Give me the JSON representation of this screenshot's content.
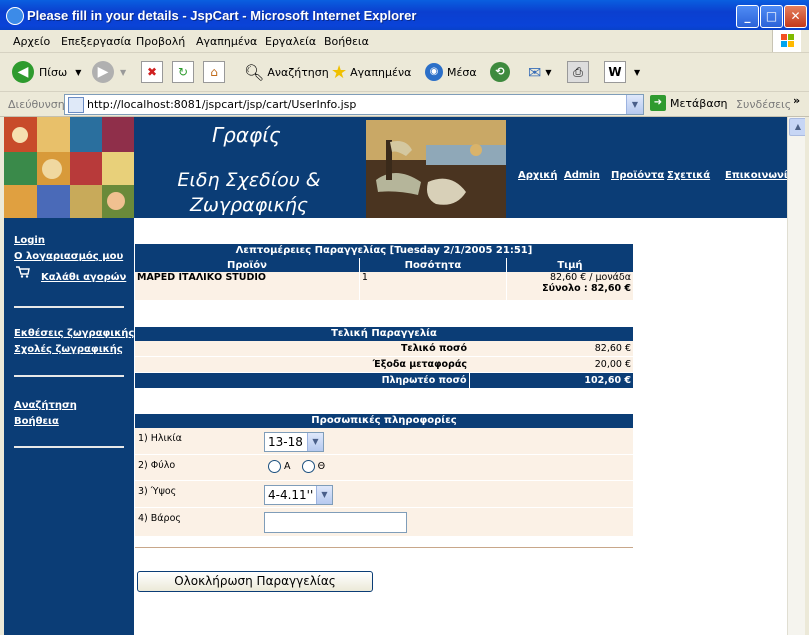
{
  "window": {
    "title": "Please fill in your details - JspCart - Microsoft Internet Explorer"
  },
  "menu": [
    "Αρχείο",
    "Επεξεργασία",
    "Προβολή",
    "Αγαπημένα",
    "Εργαλεία",
    "Βοήθεια"
  ],
  "toolbar": {
    "back": "Πίσω",
    "search": "Αναζήτηση",
    "favorites": "Αγαπημένα",
    "media": "Μέσα"
  },
  "address": {
    "label": "Διεύθυνση",
    "url": "http://localhost:8081/jspcart/jsp/cart/UserInfo.jsp",
    "go": "Μετάβαση",
    "links": "Συνδέσεις"
  },
  "banner": {
    "title": "Γραφίς",
    "subtitle": "Ειδη Σχεδίου & Ζωγραφικής"
  },
  "nav": [
    "Αρχική",
    "Admin",
    "Προϊόντα",
    "Σχετικά",
    "Επικοινωνία"
  ],
  "sidebar": {
    "login": "Login",
    "account": "Ο λογαριασμός μου",
    "cart": "Καλάθι αγορών",
    "exhibitions": "Εκθέσεις ζωγραφικής",
    "schools": "Σχολές ζωγραφικής",
    "search": "Αναζήτηση",
    "help": "Βοήθεια"
  },
  "order": {
    "header": "Λεπτομέρειες Παραγγελίας [Tuesday 2/1/2005 21:51]",
    "columns": [
      "Προϊόν",
      "Ποσότητα",
      "Τιμή"
    ],
    "product": "MAPED ΙΤΑΛΙΚΟ STUDIO",
    "quantity": "1",
    "unit_price": "82,60 € / μονάδα",
    "total": "Σύνολο : 82,60 €"
  },
  "final": {
    "header": "Τελική Παραγγελία",
    "rows": [
      {
        "label": "Τελικό ποσό",
        "value": "82,60 €"
      },
      {
        "label": "Έξοδα μεταφοράς",
        "value": "20,00 €"
      },
      {
        "label": "Πληρωτέο ποσό",
        "value": "102,60 €"
      }
    ]
  },
  "personal": {
    "header": "Προσωπικές πληροφορίες",
    "age_label": "1) Ηλικία",
    "age_value": "13-18",
    "sex_label": "2) Φύλο",
    "sex_options": [
      "A",
      "Θ"
    ],
    "height_label": "3) Ύψος",
    "height_value": "4-4.11''",
    "weight_label": "4) Βάρος",
    "weight_value": ""
  },
  "submit": "Ολοκλήρωση Παραγγελίας"
}
